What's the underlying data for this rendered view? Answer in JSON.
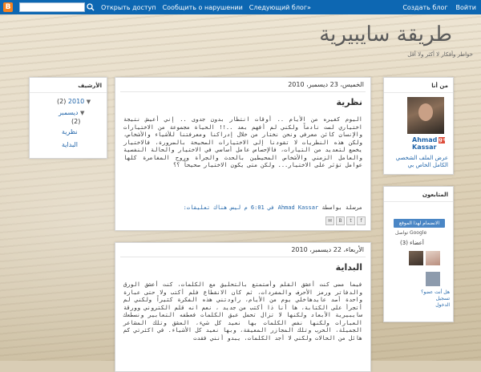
{
  "navbar": {
    "logo": "B",
    "search_placeholder": "",
    "links": [
      "Открыть доступ",
      "Сообщить о нарушении",
      "Следующий блог»"
    ],
    "right_links": [
      "Создать блог",
      "Войти"
    ],
    "brand_color": "#0d67b2"
  },
  "header": {
    "title": "طريقة سايبيرية",
    "description": "خواطر وأفكار لا أكثر ولا أقل"
  },
  "archive": {
    "title": "الأرشيف",
    "year": "2010",
    "year_count": "(2)",
    "month": "ديسمبر",
    "month_count": "(2)",
    "posts": [
      "نظرية",
      "البداية"
    ]
  },
  "about": {
    "title": "من أنا",
    "name_line1": "Ahmad",
    "name_line2": "Kassar",
    "profile_link": "عرض الملف الشخصي الكامل الخاص بي"
  },
  "followers": {
    "title": "المتابعون",
    "join_button": "الانضمام لهذا الموقع",
    "gfc": "Google تواصل",
    "members_label": "أعضاء (3)",
    "note": "هل أنت عضو؟تسجيل الدخول"
  },
  "posts": [
    {
      "date": "الخميس، 23 ديسمبر، 2010",
      "title": "نظرية",
      "body": "اليوم كغيره من الأيام .. أوقات انتظار بدون جدوى .. إني أعيش نتيجة اختياري لست نادماً ولكني لم أفهم بعد ..!! الحياة مجموعة من الاختيارات والإنسان كائن معرفي ونحن نختار من خلال إدراكنا ومعرفتنا للأشياء والأشخاص، ولكن هذه النظريات لا تقودنا إلى الاختيارات الصحيحة بالضرورة، فالاختيار يخضع لتعديد من التيارات، فالإحساس عامل أساسي في الاختيار والحالة النفسية والعامل الزمني والأشخاص المحيطين بالحدث والجرأة وروح المغامرة كلها عوامل تؤثر على الاختيار... ولكن متى يكون الاختيار صحيحاً ؟؟",
      "meta_prefix": "مرسلة بواسطة",
      "author": "Ahmad Kassar",
      "meta_time": "في 6:01 م",
      "comments": "ليس هناك تعليقات:"
    },
    {
      "date": "الأربعاء، 22 ديسمبر، 2010",
      "title": "البداية",
      "body": "فيما مضى كنت أعشق القلم وأستمتع بالتحليق مع الكلمات، كنت أعشق الورق والدفاتر ورمز الأحرف والمفردات، ثم كان الانقطاع فلم أكتب ولا حتى عبارة واحدة أصد عايدهاخلي يوم من الأيام، راودتني هذه الفكرة كثيراً ولكني لم أتجرأ على الكتابة، ها أنا ذا أكتب من جديد ، نعم انه قلم الكتروني وورقة سايبيرية الأبعاد ولكنها لا تزال تحمل عبق الكلمات فعطفه التعابير ونسطعك العبارات ولكنها نفس الكلمات بها نعيد كل شيء، العشق وتلك المشاعر الجميلة، الحرب وتلك المجازر المعيقة، وبها نعيد كل الأشياء. في اكثرتي كم هائل من الحالات ولكني لا أجد الكلمات، يبدو أنني فقدت"
    }
  ]
}
